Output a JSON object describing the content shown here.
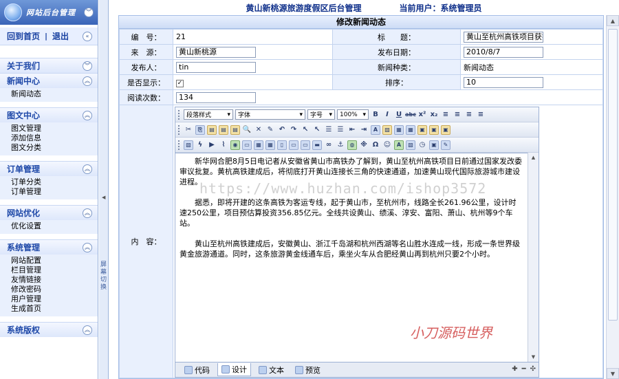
{
  "sidebar": {
    "logo_text": "网站后台管理",
    "quick": {
      "home": "回到首页",
      "sep": "|",
      "logout": "退出"
    },
    "menus": [
      {
        "title": "关于我们",
        "items": []
      },
      {
        "title": "新闻中心",
        "items": [
          "新闻动态"
        ]
      },
      {
        "title": "图文中心",
        "items": [
          "图文管理",
          "添加信息",
          "图文分类"
        ]
      },
      {
        "title": "订单管理",
        "items": [
          "订单分类",
          "订单管理"
        ]
      },
      {
        "title": "网站优化",
        "items": [
          "优化设置"
        ]
      },
      {
        "title": "系统管理",
        "items": [
          "网站配置",
          "栏目管理",
          "友情链接",
          "修改密码",
          "用户管理",
          "生成首页"
        ]
      },
      {
        "title": "系统版权",
        "items": []
      }
    ]
  },
  "splitter_text": "屏幕切换",
  "header": {
    "site_title": "黄山新桃源旅游度假区后台管理",
    "current_user": "当前用户：系统管理员"
  },
  "form": {
    "title": "修改新闻动态",
    "labels": {
      "id": "编　号：",
      "title": "标　　题：",
      "source": "来　源：",
      "publish_date": "发布日期：",
      "publisher": "发布人：",
      "category": "新闻种类：",
      "visible": "是否显示：",
      "order": "排序：",
      "views": "阅读次数：",
      "content": "内　容："
    },
    "values": {
      "id": "21",
      "title": "黄山至杭州高铁项目获批",
      "source": "黄山新桃源",
      "publish_date": "2010/8/7",
      "publisher": "tin",
      "category": "新闻动态",
      "visible": "✓",
      "order": "10",
      "views": "134"
    }
  },
  "editor": {
    "para_select": "段落样式",
    "font_select": "字体",
    "size_select": "字号",
    "zoom_select": "100%",
    "paragraphs": [
      "新华网合肥8月5日电记者从安徽省黄山市高铁办了解到，黄山至杭州高铁项目日前通过国家发改委审议批复。黄杭高铁建成后，将彻底打开黄山连接长三角的快速通道，加速黄山现代国际旅游城市建设进程。",
      "据悉，即将开建的这条高铁为客运专线，起于黄山市，至杭州市，线路全长261.96公里，设计时速250公里，项目预估算投资356.85亿元。全线共设黄山、绩溪、淳安、富阳、萧山、杭州等9个车站。",
      "黄山至杭州高铁建成后，安徽黄山、浙江千岛湖和杭州西湖等名山胜水连成一线，形成一条世界级黄金旅游通道。同时，这条旅游黄金线通车后，乘坐火车从合肥经黄山再到杭州只要2个小时。"
    ],
    "tabs": [
      "代码",
      "设计",
      "文本",
      "预览"
    ],
    "active_tab": "设计"
  },
  "watermark": "https://www.huzhan.com/ishop3572",
  "stamp": "小刀源码世界"
}
